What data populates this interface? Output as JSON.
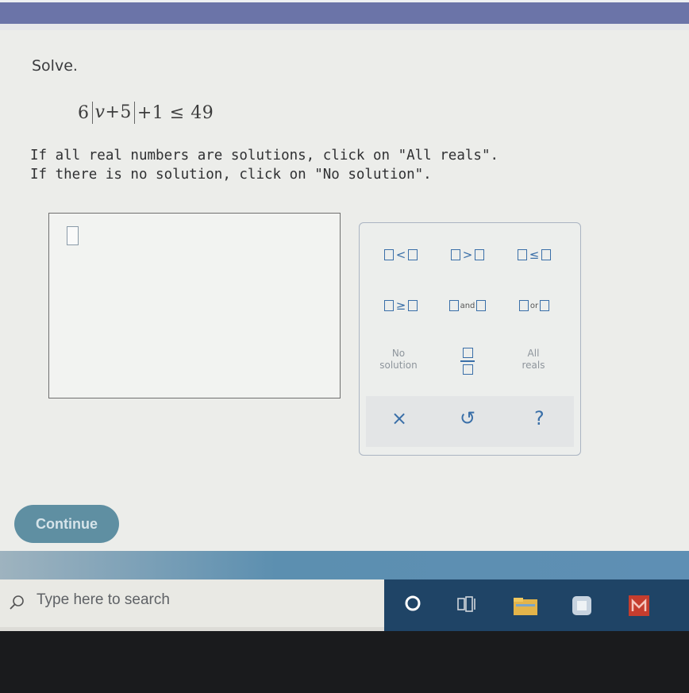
{
  "question": {
    "prompt": "Solve.",
    "equation": {
      "coefficient": "6",
      "abs_var": "v",
      "abs_plus": "+",
      "abs_const": "5",
      "rest": "+1 ≤ 49"
    },
    "instruction_line1": "If all real numbers are solutions, click on \"All reals\".",
    "instruction_line2": "If there is no solution, click on \"No solution\"."
  },
  "keypad": {
    "lt_symbol": "<",
    "gt_symbol": ">",
    "le_symbol": "≤",
    "ge_symbol": "≥",
    "and_label": "and",
    "or_label": "or",
    "no_solution_line1": "No",
    "no_solution_line2": "solution",
    "all_reals_line1": "All",
    "all_reals_line2": "reals",
    "clear_glyph": "×",
    "undo_glyph": "↺",
    "help_glyph": "?"
  },
  "continue_label": "Continue",
  "taskbar": {
    "search_placeholder": "Type here to search"
  },
  "colors": {
    "accent": "#3a6fa8",
    "continue_bg": "#5f8fa2",
    "taskbar_bg": "#1f4466"
  }
}
